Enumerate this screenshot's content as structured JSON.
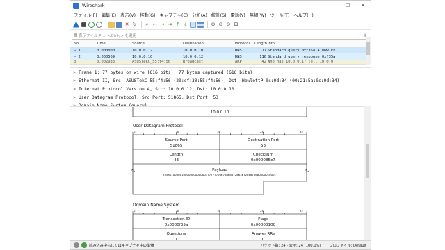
{
  "window": {
    "title": "Wireshark",
    "controls": [
      "—",
      "☐",
      "✕"
    ]
  },
  "menu": [
    "ファイル(F)",
    "編集(E)",
    "表示(V)",
    "移動(G)",
    "キャプチャ(C)",
    "分析(A)",
    "統計(S)",
    "電話(Y)",
    "無線(W)",
    "ツール(T)",
    "ヘルプ(H)"
  ],
  "filter": {
    "placeholder": "表示フィルタ … <Ctrl-/> を適用",
    "plus": "+"
  },
  "packet_list": {
    "columns": [
      "No.",
      "Time",
      "Source",
      "Destination",
      "Protocol",
      "Length",
      "Info"
    ],
    "rows": [
      {
        "marker": "→",
        "no": "1",
        "time": "0.000000",
        "source": "10.0.0.12",
        "destination": "10.0.0.10",
        "protocol": "DNS",
        "length": "77",
        "info": "Standard query 0xf35a A www.kk"
      },
      {
        "marker": "←",
        "no": "2",
        "time": "0.000509",
        "source": "10.0.0.10",
        "destination": "10.0.0.12",
        "protocol": "DNS",
        "length": "116",
        "info": "Standard query response 0xf35a"
      },
      {
        "marker": "",
        "no": "3",
        "time": "0.002933",
        "source": "ASUSTekC_55:f4:56",
        "destination": "Broadcast",
        "protocol": "ARP",
        "length": "42",
        "info": "Who has 10.0.0.1? Tell 10.0.0"
      }
    ]
  },
  "details": [
    {
      "arrow": ">",
      "text": "Frame 1: 77 bytes on wire (616 bits), 77 bytes captured (616 bits)"
    },
    {
      "arrow": ">",
      "text": "Ethernet II, Src: ASUSTekC_55:f4:56 (20:cf:30:55:f4:56), Dst: HewlettP_0c:0d:34 (00:21:5a:0c:0d:34)"
    },
    {
      "arrow": ">",
      "text": "Internet Protocol Version 4, Src: 10.0.0.12, Dst: 10.0.0.10"
    },
    {
      "arrow": ">",
      "text": "User Datagram Protocol, Src Port: 51865, Dst Port: 53"
    },
    {
      "arrow": ">",
      "text": "Domain Name System (query)"
    }
  ],
  "diagram": {
    "ip_dst": "10.0.0.10",
    "udp": {
      "title": "User Datagram Protocol",
      "ruler": [
        "0",
        "8",
        "16",
        "24",
        "32"
      ],
      "src_port_label": "Source Port",
      "src_port": "51865",
      "dst_port_label": "Destination Port",
      "dst_port": "53",
      "length_label": "Length",
      "length": "43",
      "checksum_label": "Checksum",
      "checksum": "0x000085e7",
      "payload_label": "Payload",
      "payload": "f35a010000010000000000000377777706676b6b672e63672e6a706b0000010001"
    },
    "dns": {
      "title": "Domain Name System",
      "ruler": [
        "0",
        "8",
        "16",
        "24",
        "32"
      ],
      "txid_label": "Transaction ID",
      "txid": "0x0000f35a",
      "flags_label": "Flags",
      "flags": "0x00000100",
      "questions_label": "Questions",
      "questions": "1",
      "answer_label": "Answer RRs",
      "answer": "0"
    }
  },
  "status": {
    "text": "読み込み中もしくはキャプチャ中の準備",
    "count": "パケット数: 24 · 表示: 24 (100.0%)",
    "profile": "プロファイル: Default"
  },
  "colors": {
    "selected_row": "#cbe5fb",
    "dns_row": "#dcefff",
    "accent": "#2f6fd0",
    "shark_fin": "#1f6fd1"
  }
}
